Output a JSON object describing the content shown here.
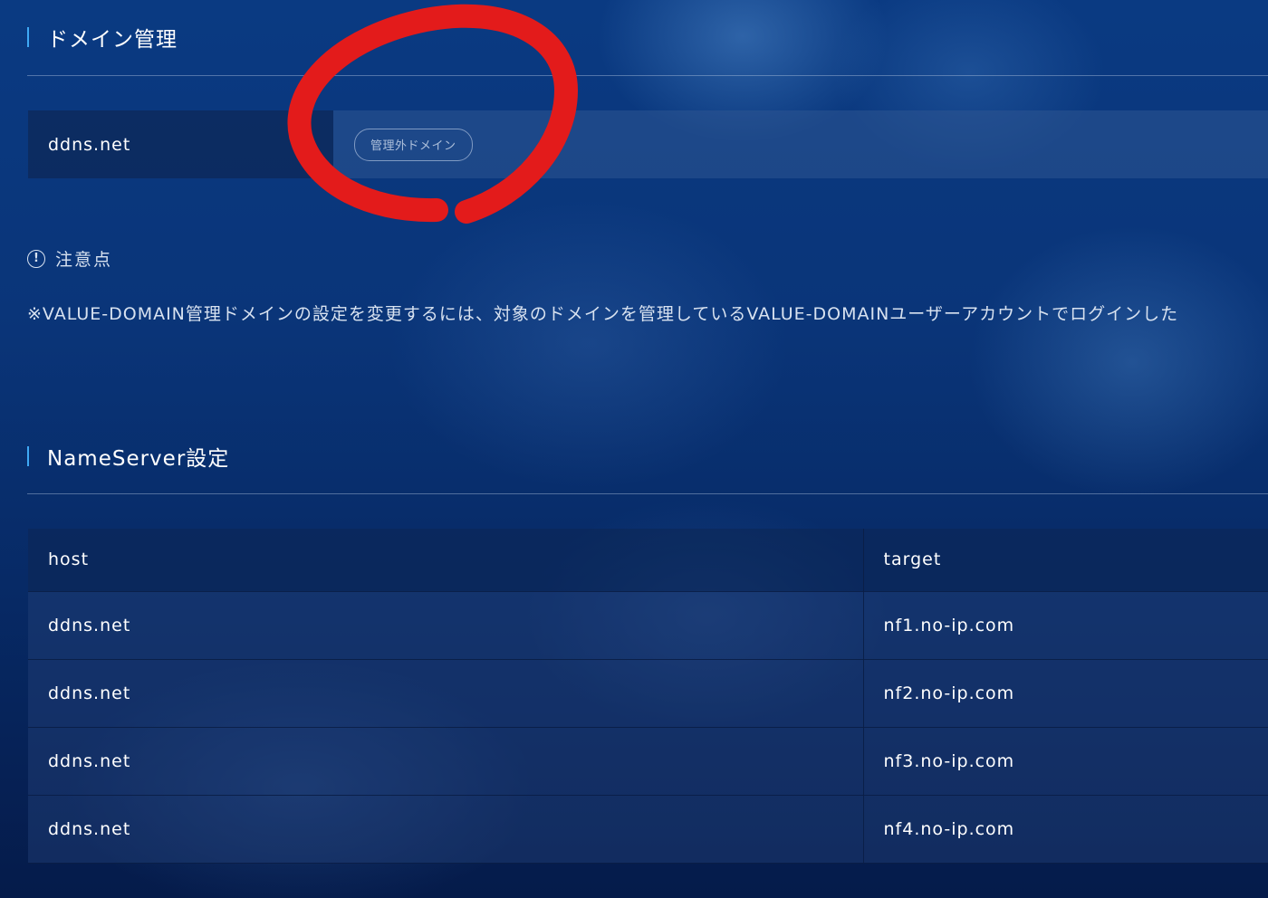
{
  "domain_section": {
    "heading": "ドメイン管理",
    "domain_name": "ddns.net",
    "status_badge": "管理外ドメイン"
  },
  "notice": {
    "icon": "exclamation-circle-icon",
    "title": "注意点",
    "text": "※VALUE-DOMAIN管理ドメインの設定を変更するには、対象のドメインを管理しているVALUE-DOMAINユーザーアカウントでログインした"
  },
  "nameserver_section": {
    "heading": "NameServer設定",
    "columns": [
      "host",
      "target"
    ],
    "rows": [
      {
        "host": "ddns.net",
        "target": "nf1.no-ip.com"
      },
      {
        "host": "ddns.net",
        "target": "nf2.no-ip.com"
      },
      {
        "host": "ddns.net",
        "target": "nf3.no-ip.com"
      },
      {
        "host": "ddns.net",
        "target": "nf4.no-ip.com"
      }
    ]
  },
  "annotation": {
    "color": "#e31b1b"
  },
  "colors": {
    "accent": "#3fa9f5",
    "background": "#0a3579"
  }
}
